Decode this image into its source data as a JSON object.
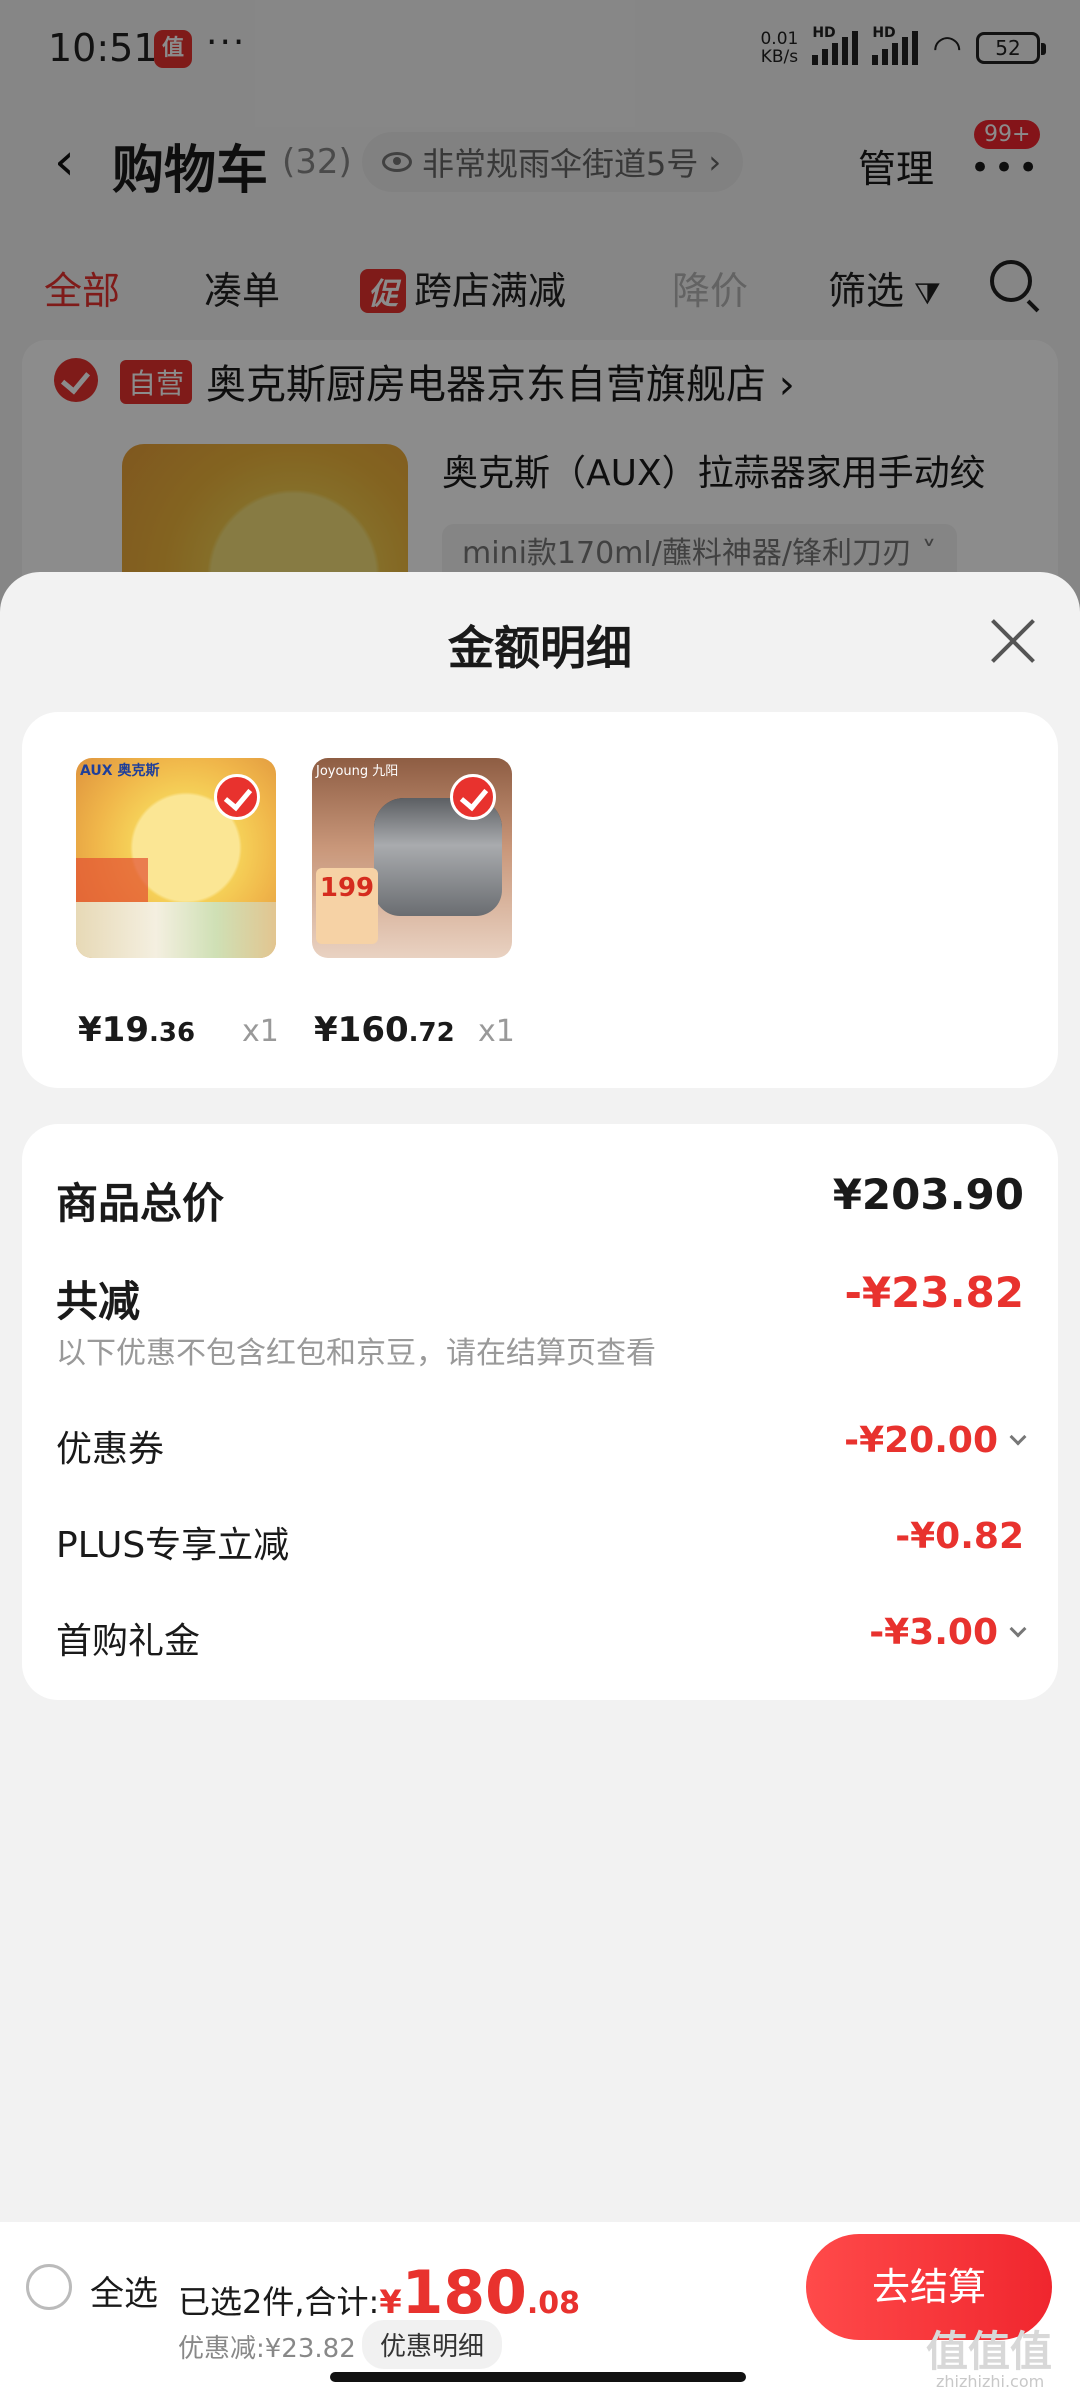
{
  "status_bar": {
    "time": "10:51",
    "app_icon_text": "值",
    "dots": "···",
    "net_speed_top": "0.01",
    "net_speed_bottom": "KB/s",
    "hd1": "HD",
    "hd2": "HD",
    "battery": "52"
  },
  "header": {
    "title": "购物车",
    "count": "(32)",
    "address": "非常规雨伞街道5号",
    "manage": "管理",
    "badge": "99+"
  },
  "tabs": {
    "all": "全部",
    "bundle": "凑单",
    "promo_tag": "促",
    "cross_store": "跨店满减",
    "price_drop": "降价",
    "filter": "筛选"
  },
  "store": {
    "self_tag": "自营",
    "name": "奥克斯厨房电器京东自营旗舰店",
    "product_title": "奥克斯（AUX）拉蒜器家用手动绞",
    "spec": "mini款170ml/蘸料神器/锋利刀刃"
  },
  "sheet": {
    "title": "金额明细",
    "items": [
      {
        "brand": "AUX 奥克斯",
        "price_main": "¥19",
        "price_decimal": ".36",
        "qty": "x1"
      },
      {
        "brand": "Joyoung 九阳",
        "thumb_label": "199",
        "price_main": "¥160",
        "price_decimal": ".72",
        "qty": "x1"
      }
    ],
    "total_label": "商品总价",
    "total_value": "¥203.90",
    "discount_label": "共减",
    "discount_value": "-¥23.82",
    "discount_note": "以下优惠不包含红包和京豆，请在结算页查看",
    "rows": [
      {
        "label": "优惠券",
        "value": "-¥20.00"
      },
      {
        "label": "PLUS专享立减",
        "value": "-¥0.82"
      },
      {
        "label": "首购礼金",
        "value": "-¥3.00"
      }
    ]
  },
  "bottom_bar": {
    "select_all": "全选",
    "selected_summary": "已选2件,合计:",
    "yen": "¥",
    "total_int": "180",
    "total_dec": ".08",
    "discount_summary": "优惠减:¥23.82",
    "detail_btn": "优惠明细",
    "checkout": "去结算",
    "watermark": "值值值",
    "watermark_sub": "zhizhizhi.com"
  },
  "colors": {
    "accent": "#e8322e",
    "background": "#f2f2f2"
  }
}
